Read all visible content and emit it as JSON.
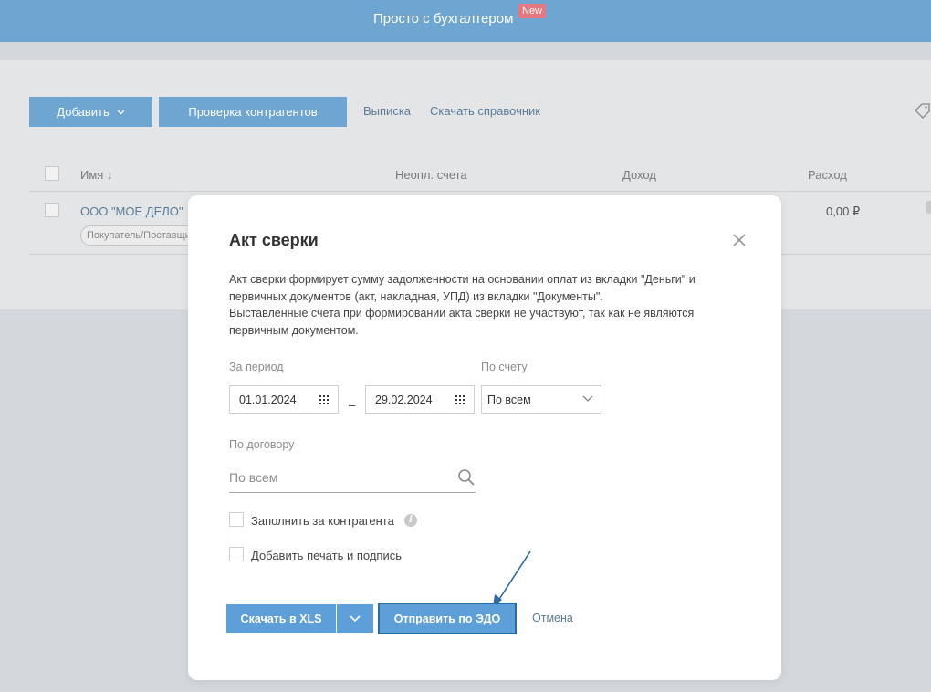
{
  "banner": {
    "title": "Просто с бухгалтером",
    "badge": "New"
  },
  "toolbar": {
    "add_label": "Добавить",
    "check_label": "Проверка контрагентов",
    "statement_link": "Выписка",
    "download_ref_link": "Скачать справочник"
  },
  "table": {
    "headers": {
      "name": "Имя ↓",
      "unpaid": "Неопл. счета",
      "income": "Доход",
      "expense": "Расход"
    },
    "rows": [
      {
        "name": "ООО \"МОЕ ДЕЛО\"",
        "tag": "Покупатель/Поставщик",
        "expense": "0,00 ₽"
      }
    ]
  },
  "modal": {
    "title": "Акт сверки",
    "description": [
      "Акт сверки формирует сумму задолженности на основании оплат из вкладки \"Деньги\" и первичных документов (акт, накладная, УПД) из вкладки \"Документы\".",
      "Выставленные счета при формировании акта сверки не участвуют, так как не являются первичным документом."
    ],
    "period_label": "За период",
    "date_from": "01.01.2024",
    "date_separator": "–",
    "date_to": "29.02.2024",
    "account_label": "По счету",
    "account_value": "По всем",
    "contract_label": "По договору",
    "contract_placeholder": "По всем",
    "fill_for_counterparty": "Заполнить за контрагента",
    "add_stamp_signature": "Добавить печать и подпись",
    "download_xls": "Скачать в XLS",
    "send_edo": "Отправить по ЭДО",
    "cancel": "Отмена"
  },
  "colors": {
    "banner": "#6ea5d1",
    "primary_button": "#5d9fd8",
    "link": "#5b7c99",
    "badge": "#e8767e"
  }
}
